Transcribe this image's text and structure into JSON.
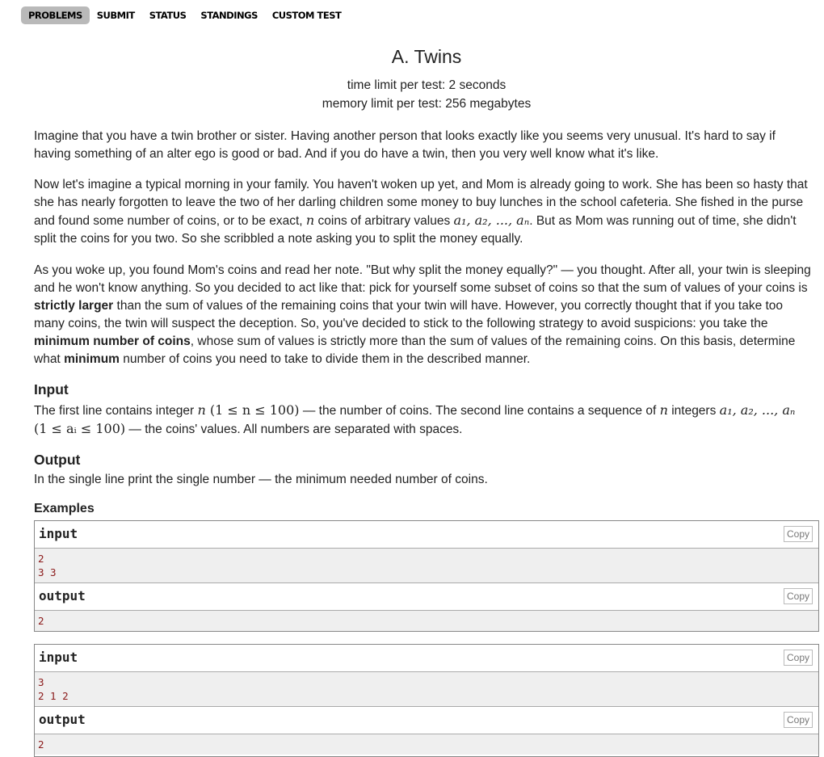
{
  "nav": {
    "items": [
      {
        "label": "PROBLEMS",
        "active": true
      },
      {
        "label": "SUBMIT",
        "active": false
      },
      {
        "label": "STATUS",
        "active": false
      },
      {
        "label": "STANDINGS",
        "active": false
      },
      {
        "label": "CUSTOM TEST",
        "active": false
      }
    ]
  },
  "problem": {
    "title": "A. Twins",
    "time_limit": "time limit per test: 2 seconds",
    "memory_limit": "memory limit per test: 256 megabytes"
  },
  "statement": {
    "p1": "Imagine that you have a twin brother or sister. Having another person that looks exactly like you seems very unusual. It's hard to say if having something of an alter ego is good or bad. And if you do have a twin, then you very well know what it's like.",
    "p2_a": "Now let's imagine a typical morning in your family. You haven't woken up yet, and Mom is already going to work. She has been so hasty that she has nearly forgotten to leave the two of her darling children some money to buy lunches in the school cafeteria. She fished in the purse and found some number of coins, or to be exact, ",
    "p2_n": "n",
    "p2_b": " coins of arbitrary values ",
    "p2_seq": "a₁, a₂, ..., aₙ",
    "p2_c": ". But as Mom was running out of time, she didn't split the coins for you two. So she scribbled a note asking you to split the money equally.",
    "p3_a": "As you woke up, you found Mom's coins and read her note. \"But why split the money equally?\" — you thought. After all, your twin is sleeping and he won't know anything. So you decided to act like that: pick for yourself some subset of coins so that the sum of values of your coins is ",
    "p3_bold1": "strictly larger",
    "p3_b": " than the sum of values of the remaining coins that your twin will have. However, you correctly thought that if you take too many coins, the twin will suspect the deception. So, you've decided to stick to the following strategy to avoid suspicions: you take the ",
    "p3_bold2": "minimum number of coins",
    "p3_c": ", whose sum of values is strictly more than the sum of values of the remaining coins. On this basis, determine what ",
    "p3_bold3": "minimum",
    "p3_d": " number of coins you need to take to divide them in the described manner."
  },
  "input_section": {
    "title": "Input",
    "t_a": "The first line contains integer ",
    "t_n": "n",
    "t_range": " (1 ≤ n ≤ 100)",
    "t_b": " — the number of coins. The second line contains a sequence of ",
    "t_n2": "n",
    "t_c": " integers ",
    "t_seq": "a₁, a₂, ..., aₙ",
    "t_range2": "(1 ≤ aᵢ ≤ 100)",
    "t_d": " — the coins' values. All numbers are separated with spaces."
  },
  "output_section": {
    "title": "Output",
    "text": "In the single line print the single number — the minimum needed number of coins."
  },
  "examples": {
    "title": "Examples",
    "copy_label": "Copy",
    "input_label": "input",
    "output_label": "output",
    "list": [
      {
        "input": [
          "2",
          "3 3"
        ],
        "output": [
          "2"
        ]
      },
      {
        "input": [
          "3",
          "2 1 2"
        ],
        "output": [
          "2"
        ]
      }
    ]
  }
}
